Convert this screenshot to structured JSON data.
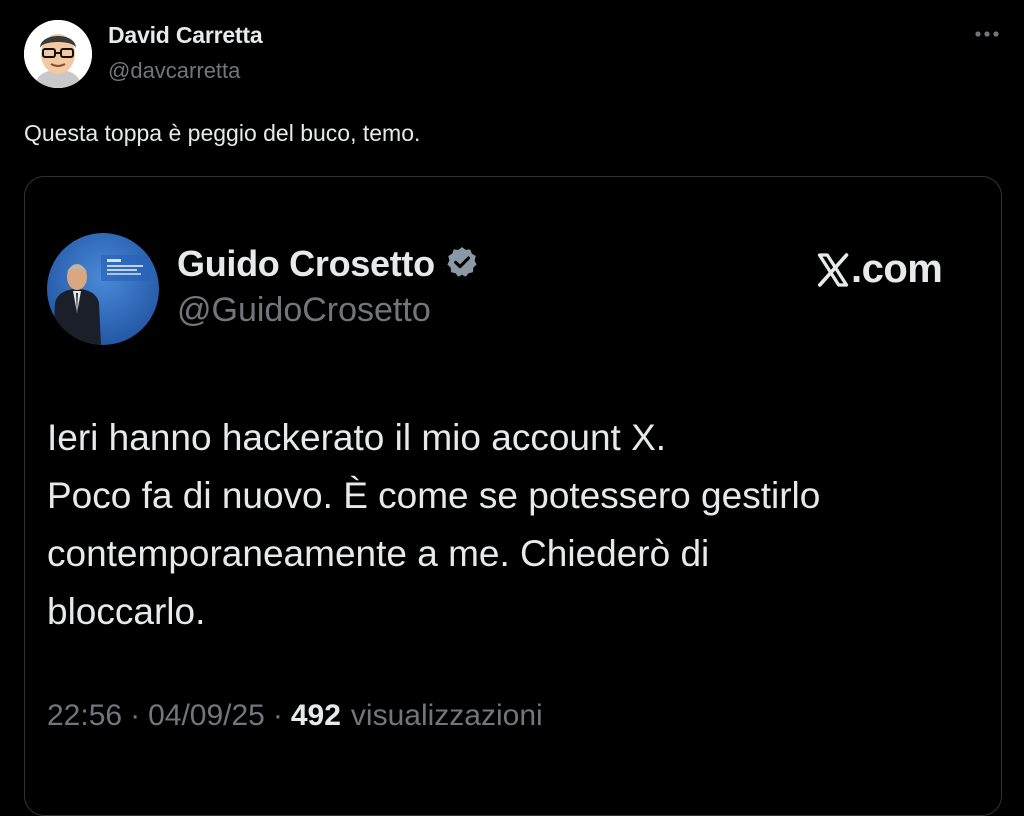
{
  "author": {
    "name": "David Carretta",
    "handle": "@davcarretta",
    "avatar_icon": "cartoon-portrait"
  },
  "tweet": {
    "text": "Questa toppa è peggio del buco, temo."
  },
  "more_icon": "more-horizontal-icon",
  "quoted_tweet": {
    "name": "Guido Crosetto",
    "handle": "@GuidoCrosetto",
    "verified_icon": "verified-badge-icon",
    "source": ".com",
    "text_lines": [
      "Ieri hanno hackerato il mio account X.",
      "Poco fa di nuovo. È come se potessero gestirlo",
      "contemporaneamente a me. Chiederò di",
      "bloccarlo."
    ],
    "time": "22:56",
    "date": "04/09/25",
    "views_count": "492",
    "views_label": "visualizzazioni"
  },
  "colors": {
    "background": "#000000",
    "text_primary": "#e7e9ea",
    "text_secondary": "#71767b",
    "border": "#2f3336",
    "verified": "#8b98a5"
  }
}
